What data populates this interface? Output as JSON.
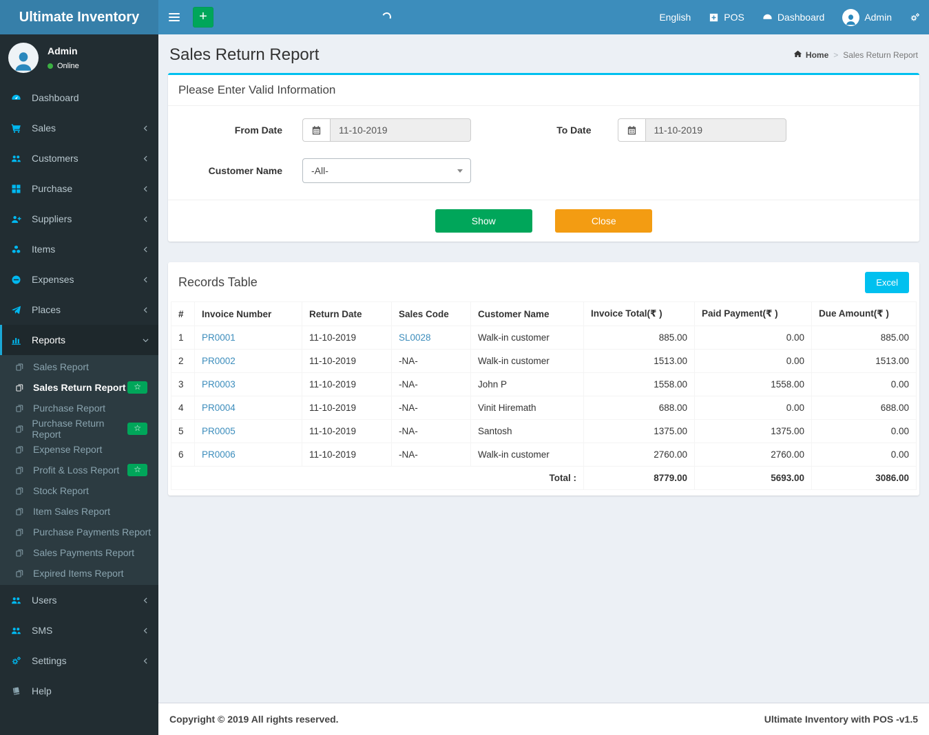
{
  "navbar": {
    "brand": "Ultimate Inventory",
    "language": "English",
    "pos_label": "POS",
    "dashboard_label": "Dashboard",
    "user_name": "Admin"
  },
  "sidebar": {
    "user": {
      "name": "Admin",
      "status": "Online"
    },
    "menu": [
      {
        "label": "Dashboard",
        "icon": "gauge"
      },
      {
        "label": "Sales",
        "icon": "cart",
        "chevron": "left"
      },
      {
        "label": "Customers",
        "icon": "users",
        "chevron": "left"
      },
      {
        "label": "Purchase",
        "icon": "grid",
        "chevron": "left"
      },
      {
        "label": "Suppliers",
        "icon": "user-plus",
        "chevron": "left"
      },
      {
        "label": "Items",
        "icon": "cubes",
        "chevron": "left"
      },
      {
        "label": "Expenses",
        "icon": "minus-circle",
        "chevron": "left"
      },
      {
        "label": "Places",
        "icon": "paper-plane",
        "chevron": "left"
      },
      {
        "label": "Reports",
        "icon": "bar-chart",
        "chevron": "down",
        "active": true,
        "submenu": [
          {
            "label": "Sales Report"
          },
          {
            "label": "Sales Return Report",
            "active": true,
            "badge": "star"
          },
          {
            "label": "Purchase Report"
          },
          {
            "label": "Purchase Return Report",
            "badge": "star"
          },
          {
            "label": "Expense Report"
          },
          {
            "label": "Profit & Loss Report",
            "badge": "star"
          },
          {
            "label": "Stock Report"
          },
          {
            "label": "Item Sales Report"
          },
          {
            "label": "Purchase Payments Report"
          },
          {
            "label": "Sales Payments Report"
          },
          {
            "label": "Expired Items Report"
          }
        ]
      },
      {
        "label": "Users",
        "icon": "users",
        "chevron": "left"
      },
      {
        "label": "SMS",
        "icon": "users",
        "chevron": "left"
      },
      {
        "label": "Settings",
        "icon": "cogs",
        "chevron": "left"
      },
      {
        "label": "Help",
        "icon": "book",
        "muted": true
      }
    ]
  },
  "page": {
    "title": "Sales Return Report",
    "breadcrumb_home": "Home",
    "breadcrumb_sep": ">",
    "breadcrumb_current": "Sales Return Report"
  },
  "filter": {
    "panel_title": "Please Enter Valid Information",
    "from_date": {
      "label": "From Date",
      "value": "11-10-2019"
    },
    "to_date": {
      "label": "To Date",
      "value": "11-10-2019"
    },
    "customer": {
      "label": "Customer Name",
      "value": "-All-"
    },
    "show_button": "Show",
    "close_button": "Close"
  },
  "records": {
    "panel_title": "Records Table",
    "excel_button": "Excel",
    "columns": [
      "#",
      "Invoice Number",
      "Return Date",
      "Sales Code",
      "Customer Name",
      "Invoice Total(₹ )",
      "Paid Payment(₹ )",
      "Due Amount(₹ )"
    ],
    "rows": [
      {
        "sn": "1",
        "invoice": "PR0001",
        "return_date": "11-10-2019",
        "sales_code": "SL0028",
        "sales_code_is_link": true,
        "customer": "Walk-in customer",
        "invoice_total": "885.00",
        "paid_payment": "0.00",
        "due_amount": "885.00"
      },
      {
        "sn": "2",
        "invoice": "PR0002",
        "return_date": "11-10-2019",
        "sales_code": "-NA-",
        "sales_code_is_link": false,
        "customer": "Walk-in customer",
        "invoice_total": "1513.00",
        "paid_payment": "0.00",
        "due_amount": "1513.00"
      },
      {
        "sn": "3",
        "invoice": "PR0003",
        "return_date": "11-10-2019",
        "sales_code": "-NA-",
        "sales_code_is_link": false,
        "customer": "John P",
        "invoice_total": "1558.00",
        "paid_payment": "1558.00",
        "due_amount": "0.00"
      },
      {
        "sn": "4",
        "invoice": "PR0004",
        "return_date": "11-10-2019",
        "sales_code": "-NA-",
        "sales_code_is_link": false,
        "customer": "Vinit Hiremath",
        "invoice_total": "688.00",
        "paid_payment": "0.00",
        "due_amount": "688.00"
      },
      {
        "sn": "5",
        "invoice": "PR0005",
        "return_date": "11-10-2019",
        "sales_code": "-NA-",
        "sales_code_is_link": false,
        "customer": "Santosh",
        "invoice_total": "1375.00",
        "paid_payment": "1375.00",
        "due_amount": "0.00"
      },
      {
        "sn": "6",
        "invoice": "PR0006",
        "return_date": "11-10-2019",
        "sales_code": "-NA-",
        "sales_code_is_link": false,
        "customer": "Walk-in customer",
        "invoice_total": "2760.00",
        "paid_payment": "2760.00",
        "due_amount": "0.00"
      }
    ],
    "total_row": {
      "label": "Total :",
      "invoice_total": "8779.00",
      "paid_payment": "5693.00",
      "due_amount": "3086.00"
    }
  },
  "footer": {
    "left": "Copyright © 2019 All rights reserved.",
    "right": "Ultimate Inventory with POS -v1.5"
  },
  "colors": {
    "navbar": "#3c8dbc",
    "logo_bg": "#367fa9",
    "sidebar_bg": "#222d32",
    "submenu_bg": "#2c3b41",
    "active_item_bg": "#1e282c",
    "icon_accent": "#00b8f0",
    "panel_accent": "#00c0ef",
    "link": "#3c8dbc",
    "success": "#00a65a",
    "warning": "#f39c12",
    "badge_green": "#00a65a",
    "content_bg": "#ecf0f5"
  }
}
